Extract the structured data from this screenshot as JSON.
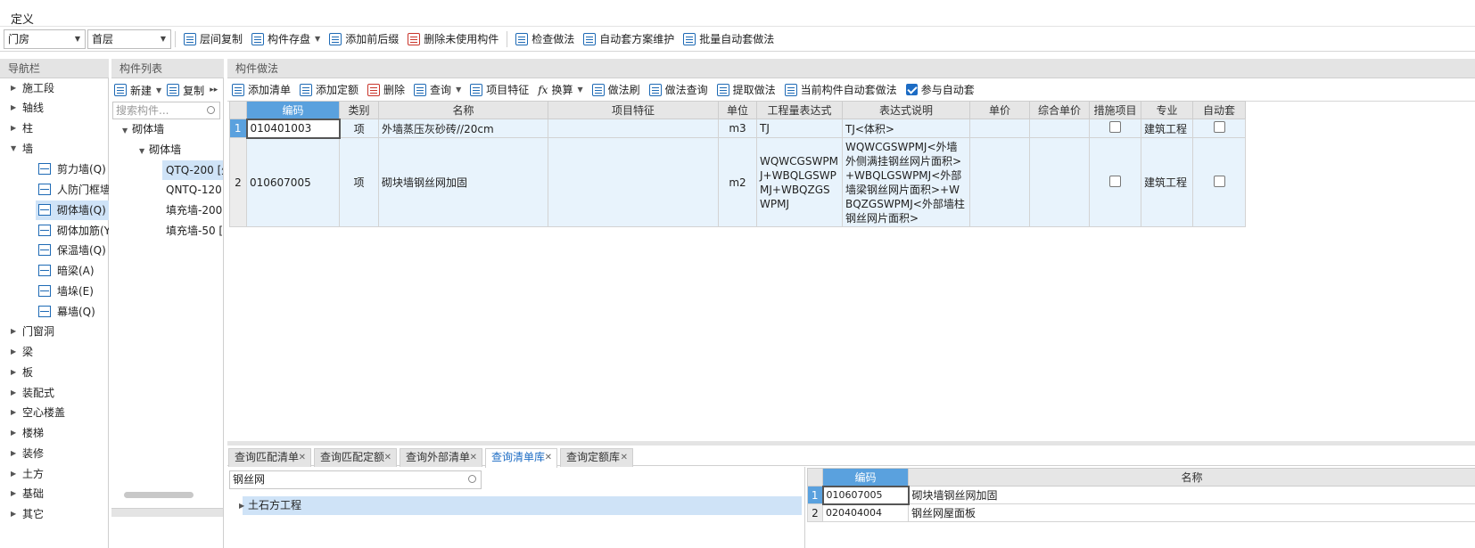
{
  "window": {
    "title": "定义"
  },
  "toolbar1": {
    "combo1": "门房",
    "combo2": "首层",
    "buttons": [
      "层间复制",
      "构件存盘",
      "添加前后缀",
      "删除未使用构件",
      "检查做法",
      "自动套方案维护",
      "批量自动套做法"
    ]
  },
  "nav": {
    "header": "导航栏",
    "items_top": [
      "施工段",
      "轴线",
      "柱",
      "墙"
    ],
    "wall_children": [
      "剪力墙(Q)",
      "人防门框墙",
      "砌体墙(Q)",
      "砌体加筋(Y",
      "保温墙(Q)",
      "暗梁(A)",
      "墙垛(E)",
      "幕墙(Q)"
    ],
    "items_bottom": [
      "门窗洞",
      "梁",
      "板",
      "装配式",
      "空心楼盖",
      "楼梯",
      "装修",
      "土方",
      "基础",
      "其它"
    ]
  },
  "complist": {
    "header": "构件列表",
    "new_label": "新建",
    "copy_label": "复制",
    "search_placeholder": "搜索构件...",
    "tree": [
      "砌体墙",
      "砌体墙",
      "QTQ-200 [外",
      "QNTQ-120",
      "填充墙-200 [",
      "填充墙-50 [外"
    ]
  },
  "method": {
    "header": "构件做法",
    "toolbar": [
      "添加清单",
      "添加定额",
      "删除",
      "查询",
      "项目特征",
      "换算",
      "做法刷",
      "做法查询",
      "提取做法",
      "当前构件自动套做法",
      "参与自动套"
    ],
    "auto_checked": true,
    "columns": [
      "编码",
      "类别",
      "名称",
      "项目特征",
      "单位",
      "工程量表达式",
      "表达式说明",
      "单价",
      "综合单价",
      "措施项目",
      "专业",
      "自动套"
    ],
    "rows": [
      {
        "no": "1",
        "code": "010401003",
        "type": "项",
        "name": "外墙蒸压灰砂砖//20cm",
        "feature": "",
        "unit": "m3",
        "expr": "TJ",
        "desc": "TJ<体积>",
        "price": "",
        "total": "",
        "measure": false,
        "major": "建筑工程",
        "auto": false
      },
      {
        "no": "2",
        "code": "010607005",
        "type": "项",
        "name": "砌块墙钢丝网加固",
        "feature": "",
        "unit": "m2",
        "expr": "WQWCGSWPMJ+WBQLGSWPMJ+WBQZGSWPMJ",
        "desc": "WQWCGSWPMJ<外墙外侧满挂钢丝网片面积>+WBQLGSWPMJ<外部墙梁钢丝网片面积>+WBQZGSWPMJ<外部墙柱钢丝网片面积>",
        "price": "",
        "total": "",
        "measure": false,
        "major": "建筑工程",
        "auto": false
      }
    ]
  },
  "bottom": {
    "tabs": [
      "查询匹配清单",
      "查询匹配定额",
      "查询外部清单",
      "查询清单库",
      "查询定额库"
    ],
    "active_tab": 3,
    "search_value": "钢丝网",
    "tree_item": "土石方工程",
    "columns": [
      "编码",
      "名称"
    ],
    "rows": [
      {
        "no": "1",
        "code": "010607005",
        "name": "砌块墙钢丝网加固"
      },
      {
        "no": "2",
        "code": "020404004",
        "name": "钢丝网屋面板"
      }
    ]
  }
}
